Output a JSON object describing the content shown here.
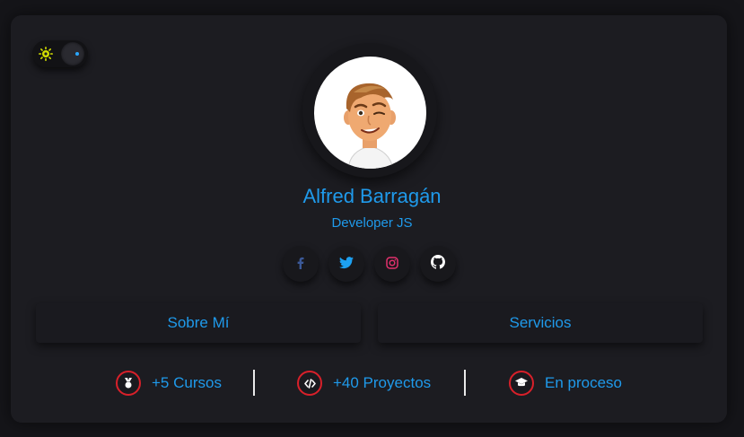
{
  "profile": {
    "name": "Alfred Barragán",
    "role": "Developer JS"
  },
  "theme_toggle": {
    "icon": "sun-icon",
    "state": "dark"
  },
  "socials": [
    {
      "icon": "facebook-icon",
      "color": "#3b5998"
    },
    {
      "icon": "twitter-icon",
      "color": "#1da1f2"
    },
    {
      "icon": "instagram-icon",
      "color": "#e1306c"
    },
    {
      "icon": "github-icon",
      "color": "#ffffff"
    }
  ],
  "buttons": {
    "about": "Sobre Mí",
    "services": "Servicios"
  },
  "stats": [
    {
      "icon": "medal-icon",
      "label": "+5 Cursos"
    },
    {
      "icon": "code-icon",
      "label": "+40 Proyectos"
    },
    {
      "icon": "graduation-cap-icon",
      "label": "En proceso"
    }
  ],
  "colors": {
    "accent": "#1f9aeb",
    "icon_ring": "#d8202a",
    "card": "#1c1c21",
    "background": "#151519"
  }
}
